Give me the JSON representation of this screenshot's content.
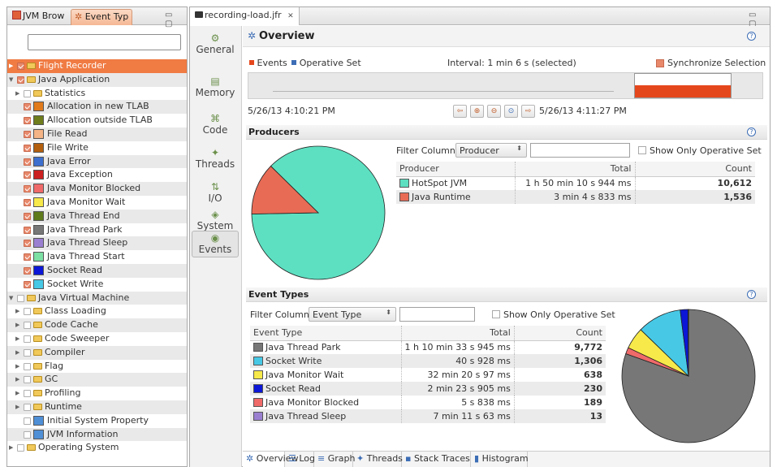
{
  "left_panel": {
    "tabs": [
      "JVM Brow",
      "Event Typ"
    ],
    "window_controls": "▭ ▢",
    "filter_value": "",
    "tree": [
      {
        "label": "Flight Recorder",
        "level": 0,
        "expander": "▶",
        "checkbox": "partial-on",
        "folder": true,
        "selected": true
      },
      {
        "label": "Java Application",
        "level": 0,
        "expander": "▼",
        "checkbox": "partial-on",
        "folder": true
      },
      {
        "label": "Statistics",
        "level": 1,
        "expander": "▶",
        "checkbox": "off",
        "folder": true
      },
      {
        "label": "Allocation in new TLAB",
        "level": 1,
        "checkbox": "on",
        "color": "#e07a1b"
      },
      {
        "label": "Allocation outside TLAB",
        "level": 1,
        "checkbox": "on",
        "color": "#6f7d1c"
      },
      {
        "label": "File Read",
        "level": 1,
        "checkbox": "on",
        "color": "#f5b485"
      },
      {
        "label": "File Write",
        "level": 1,
        "checkbox": "on",
        "color": "#b35f0e"
      },
      {
        "label": "Java Error",
        "level": 1,
        "checkbox": "on",
        "color": "#3d6fcf"
      },
      {
        "label": "Java Exception",
        "level": 1,
        "checkbox": "on",
        "color": "#cc1f1f"
      },
      {
        "label": "Java Monitor Blocked",
        "level": 1,
        "checkbox": "on",
        "color": "#f06a6a"
      },
      {
        "label": "Java Monitor Wait",
        "level": 1,
        "checkbox": "on",
        "color": "#f7e94a"
      },
      {
        "label": "Java Thread End",
        "level": 1,
        "checkbox": "on",
        "color": "#5e7a1b"
      },
      {
        "label": "Java Thread Park",
        "level": 1,
        "checkbox": "on",
        "color": "#777777"
      },
      {
        "label": "Java Thread Sleep",
        "level": 1,
        "checkbox": "on",
        "color": "#9a7fd1"
      },
      {
        "label": "Java Thread Start",
        "level": 1,
        "checkbox": "on",
        "color": "#7de0a4"
      },
      {
        "label": "Socket Read",
        "level": 1,
        "checkbox": "on",
        "color": "#0b16d6"
      },
      {
        "label": "Socket Write",
        "level": 1,
        "checkbox": "on",
        "color": "#47c9e6"
      },
      {
        "label": "Java Virtual Machine",
        "level": 0,
        "expander": "▼",
        "checkbox": "off",
        "folder": true
      },
      {
        "label": "Class Loading",
        "level": 1,
        "expander": "▶",
        "checkbox": "off",
        "folder": true
      },
      {
        "label": "Code Cache",
        "level": 1,
        "expander": "▶",
        "checkbox": "off",
        "folder": true
      },
      {
        "label": "Code Sweeper",
        "level": 1,
        "expander": "▶",
        "checkbox": "off",
        "folder": true
      },
      {
        "label": "Compiler",
        "level": 1,
        "expander": "▶",
        "checkbox": "off",
        "folder": true
      },
      {
        "label": "Flag",
        "level": 1,
        "expander": "▶",
        "checkbox": "off",
        "folder": true
      },
      {
        "label": "GC",
        "level": 1,
        "expander": "▶",
        "checkbox": "off",
        "folder": true
      },
      {
        "label": "Profiling",
        "level": 1,
        "expander": "▶",
        "checkbox": "off",
        "folder": true
      },
      {
        "label": "Runtime",
        "level": 1,
        "expander": "▶",
        "checkbox": "off",
        "folder": true
      },
      {
        "label": "Initial System Property",
        "level": 1,
        "checkbox": "off",
        "color": "#4f8fd6"
      },
      {
        "label": "JVM Information",
        "level": 1,
        "checkbox": "off",
        "color": "#4f8fd6"
      },
      {
        "label": "Operating System",
        "level": 0,
        "expander": "▶",
        "checkbox": "off",
        "folder": true
      }
    ]
  },
  "editor": {
    "tab_label": "recording-load.jfr",
    "tab_close": "✕",
    "window_controls": "▭ ▢",
    "nav": [
      {
        "label": "General",
        "icon": "general-icon",
        "glyph": "⚙"
      },
      {
        "label": "Memory",
        "icon": "memory-icon",
        "glyph": "▤"
      },
      {
        "label": "Code",
        "icon": "code-icon",
        "glyph": "⌘"
      },
      {
        "label": "Threads",
        "icon": "threads-icon",
        "glyph": "✦"
      },
      {
        "label": "I/O",
        "icon": "io-icon",
        "glyph": "⇅"
      },
      {
        "label": "System",
        "icon": "system-icon",
        "glyph": "◈"
      },
      {
        "label": "Events",
        "icon": "events-icon",
        "glyph": "◉",
        "active": true
      }
    ],
    "overview": {
      "title": "Overview",
      "legend_events": "Events",
      "legend_operative": "Operative Set",
      "interval_text": "Interval: 1 min 6 s (selected)",
      "sync_label": "Synchronize Selection",
      "sync_checked": true,
      "start_time": "5/26/13 4:10:21 PM",
      "end_time": "5/26/13 4:11:27 PM",
      "selection_start": 0.75,
      "selection_end": 0.94
    },
    "producers": {
      "title": "Producers",
      "filter_label": "Filter Column",
      "filter_value": "Producer",
      "filter_text": "",
      "show_operative_label": "Show Only Operative Set",
      "columns": [
        "Producer",
        "Total",
        "Count"
      ],
      "rows": [
        {
          "name": "HotSpot JVM",
          "color": "#5de0c1",
          "total": "1 h 50 min 10 s 944 ms",
          "count": "10,612"
        },
        {
          "name": "Java Runtime",
          "color": "#e86b56",
          "total": "3 min 4 s 833 ms",
          "count": "1,536"
        }
      ]
    },
    "event_types": {
      "title": "Event Types",
      "filter_label": "Filter Column",
      "filter_value": "Event Type",
      "filter_text": "",
      "show_operative_label": "Show Only Operative Set",
      "columns": [
        "Event Type",
        "Total",
        "Count"
      ],
      "rows": [
        {
          "name": "Java Thread Park",
          "color": "#777777",
          "total": "1 h 10 min 33 s 945 ms",
          "count": "9,772"
        },
        {
          "name": "Socket Write",
          "color": "#47c9e6",
          "total": "40 s 928 ms",
          "count": "1,306"
        },
        {
          "name": "Java Monitor Wait",
          "color": "#f7e94a",
          "total": "32 min 20 s 97 ms",
          "count": "638"
        },
        {
          "name": "Socket Read",
          "color": "#0b16d6",
          "total": "2 min 23 s 905 ms",
          "count": "230"
        },
        {
          "name": "Java Monitor Blocked",
          "color": "#f06a6a",
          "total": "5 s 838 ms",
          "count": "189"
        },
        {
          "name": "Java Thread Sleep",
          "color": "#9a7fd1",
          "total": "7 min 11 s 63 ms",
          "count": "13"
        }
      ]
    },
    "bottom_tabs": [
      "Overview",
      "Log",
      "Graph",
      "Threads",
      "Stack Traces",
      "Histogram"
    ]
  },
  "chart_data": [
    {
      "type": "pie",
      "series": [
        {
          "name": "HotSpot JVM",
          "value": 10612,
          "color": "#5de0c1"
        },
        {
          "name": "Java Runtime",
          "value": 1536,
          "color": "#e86b56"
        }
      ]
    },
    {
      "type": "pie",
      "series": [
        {
          "name": "Java Thread Park",
          "value": 9772,
          "color": "#777777"
        },
        {
          "name": "Java Monitor Blocked",
          "value": 189,
          "color": "#f06a6a"
        },
        {
          "name": "Java Monitor Wait",
          "value": 638,
          "color": "#f7e94a"
        },
        {
          "name": "Socket Write",
          "value": 1306,
          "color": "#47c9e6"
        },
        {
          "name": "Socket Read",
          "value": 230,
          "color": "#0b16d6"
        },
        {
          "name": "Java Thread Sleep",
          "value": 13,
          "color": "#9a7fd1"
        }
      ]
    }
  ]
}
